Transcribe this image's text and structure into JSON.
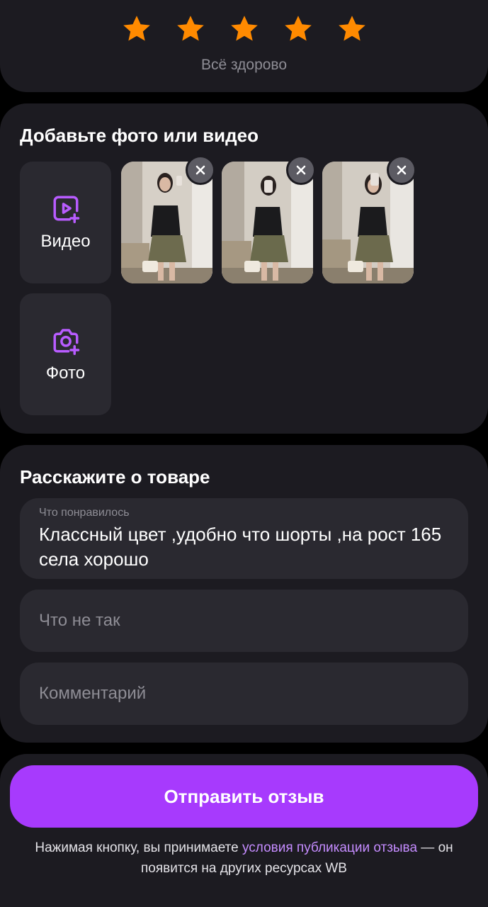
{
  "rating": {
    "value": 5,
    "max": 5,
    "caption": "Всё здорово",
    "star_color": "#ff8a00"
  },
  "media": {
    "title": "Добавьте фото или видео",
    "video_label": "Видео",
    "photo_label": "Фото",
    "video_icon": "video-plus-icon",
    "photo_icon": "camera-plus-icon",
    "remove_icon": "close-icon",
    "thumbnails": 3,
    "accent_color": "#b85cff"
  },
  "review": {
    "title": "Расскажите о товаре",
    "liked_label": "Что понравилось",
    "liked_value": "Классный цвет ,удобно что шорты ,на рост 165 села хорошо",
    "disliked_placeholder": "Что не так",
    "comment_placeholder": "Комментарий"
  },
  "footer": {
    "submit_label": "Отправить отзыв",
    "legal_prefix": "Нажимая кнопку, вы принимаете ",
    "legal_link": "условия публикации отзыва",
    "legal_suffix": " — он появится на других ресурсах WB",
    "button_color": "#a73afd",
    "link_color": "#c58cff"
  }
}
